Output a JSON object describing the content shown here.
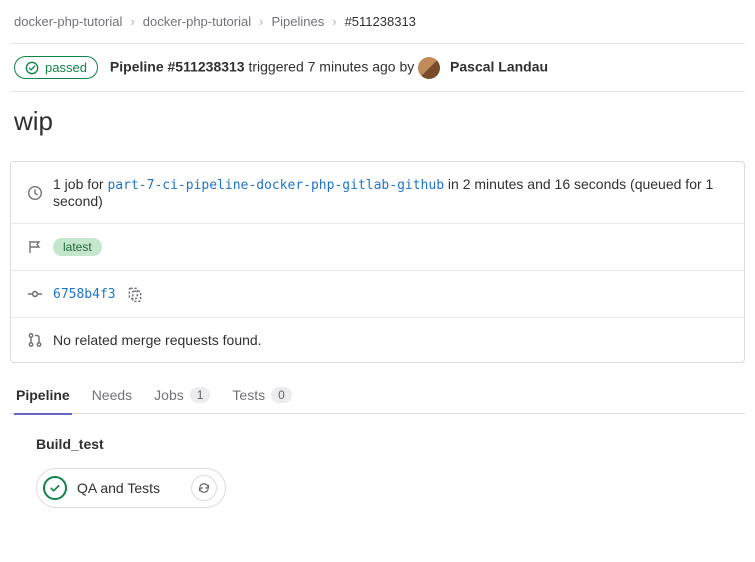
{
  "breadcrumbs": {
    "group": "docker-php-tutorial",
    "project": "docker-php-tutorial",
    "section": "Pipelines",
    "current": "#511238313"
  },
  "header": {
    "status_label": "passed",
    "pipeline_label": "Pipeline #511238313",
    "triggered_text": "triggered 7 minutes ago by",
    "user_name": "Pascal Landau"
  },
  "title": "wip",
  "summary": {
    "job_count_prefix": "1 job for",
    "branch": "part-7-ci-pipeline-docker-php-gitlab-github",
    "duration_text": "in 2 minutes and 16 seconds (queued for 1 second)",
    "latest_label": "latest",
    "commit_sha": "6758b4f3",
    "merge_requests_text": "No related merge requests found."
  },
  "tabs": {
    "pipeline": "Pipeline",
    "needs": "Needs",
    "jobs": "Jobs",
    "jobs_count": "1",
    "tests": "Tests",
    "tests_count": "0"
  },
  "pipeline_graph": {
    "stages": [
      {
        "name": "Build_test",
        "jobs": [
          {
            "name": "QA and Tests"
          }
        ]
      }
    ]
  }
}
